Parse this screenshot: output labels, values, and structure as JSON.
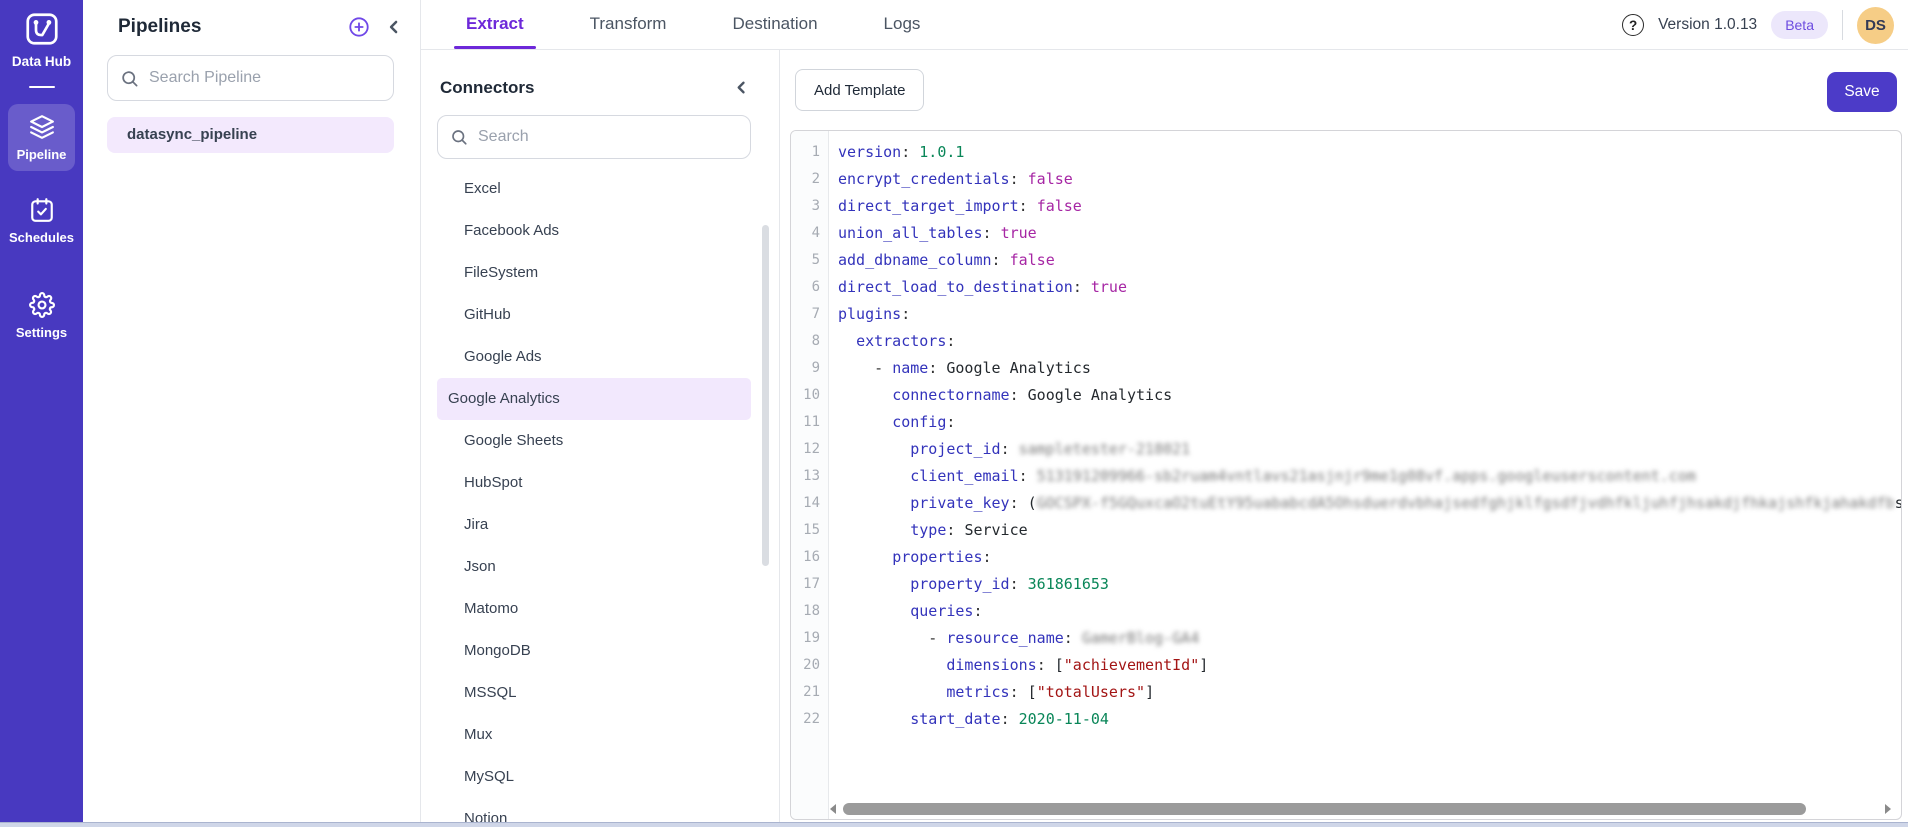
{
  "sidebar": {
    "logo_label": "Data Hub",
    "items": [
      {
        "label": "Pipeline",
        "active": true
      },
      {
        "label": "Schedules",
        "active": false
      },
      {
        "label": "Settings",
        "active": false
      }
    ]
  },
  "pipelines": {
    "title": "Pipelines",
    "search_placeholder": "Search Pipeline",
    "items": [
      {
        "name": "datasync_pipeline",
        "selected": true
      }
    ]
  },
  "tabs": [
    {
      "label": "Extract",
      "active": true
    },
    {
      "label": "Transform",
      "active": false
    },
    {
      "label": "Destination",
      "active": false
    },
    {
      "label": "Logs",
      "active": false
    }
  ],
  "topbar": {
    "version": "Version 1.0.13",
    "beta_label": "Beta",
    "help_glyph": "?",
    "avatar_initials": "DS"
  },
  "connectors": {
    "title": "Connectors",
    "search_placeholder": "Search",
    "selected": "Google Analytics",
    "items": [
      "Excel",
      "Facebook Ads",
      "FileSystem",
      "GitHub",
      "Google Ads",
      "Google Analytics",
      "Google Sheets",
      "HubSpot",
      "Jira",
      "Json",
      "Matomo",
      "MongoDB",
      "MSSQL",
      "Mux",
      "MySQL",
      "Notion"
    ]
  },
  "toolbar": {
    "add_template_label": "Add Template",
    "save_label": "Save"
  },
  "colors": {
    "accent_purple": "#6d28d9",
    "sidebar_bg": "#4839c0",
    "save_button": "#4c3bc8",
    "selection_lavender": "#f2e8fd",
    "beta_bg": "#ece7fb",
    "beta_text": "#6d4ce0",
    "avatar_bg": "#f6cd86",
    "code_key": "#3333bb",
    "code_bool": "#a626a4",
    "code_number": "#098658",
    "code_string": "#a31515"
  },
  "editor": {
    "language": "yaml",
    "lines": [
      {
        "no": 1,
        "seg": [
          [
            "version",
            "key"
          ],
          [
            ": ",
            "punc"
          ],
          [
            "1.0.1",
            "num"
          ]
        ]
      },
      {
        "no": 2,
        "seg": [
          [
            "encrypt_credentials",
            "key"
          ],
          [
            ": ",
            "punc"
          ],
          [
            "false",
            "bool"
          ]
        ]
      },
      {
        "no": 3,
        "seg": [
          [
            "direct_target_import",
            "key"
          ],
          [
            ": ",
            "punc"
          ],
          [
            "false",
            "bool"
          ]
        ]
      },
      {
        "no": 4,
        "seg": [
          [
            "union_all_tables",
            "key"
          ],
          [
            ": ",
            "punc"
          ],
          [
            "true",
            "bool"
          ]
        ]
      },
      {
        "no": 5,
        "seg": [
          [
            "add_dbname_column",
            "key"
          ],
          [
            ": ",
            "punc"
          ],
          [
            "false",
            "bool"
          ]
        ]
      },
      {
        "no": 6,
        "seg": [
          [
            "direct_load_to_destination",
            "key"
          ],
          [
            ": ",
            "punc"
          ],
          [
            "true",
            "bool"
          ]
        ]
      },
      {
        "no": 7,
        "seg": [
          [
            "plugins",
            "key"
          ],
          [
            ":",
            "punc"
          ]
        ]
      },
      {
        "no": 8,
        "seg": [
          [
            "  ",
            "plain"
          ],
          [
            "extractors",
            "key"
          ],
          [
            ":",
            "punc"
          ]
        ]
      },
      {
        "no": 9,
        "seg": [
          [
            "    - ",
            "punc"
          ],
          [
            "name",
            "key"
          ],
          [
            ": ",
            "punc"
          ],
          [
            "Google Analytics",
            "plain"
          ]
        ]
      },
      {
        "no": 10,
        "seg": [
          [
            "      ",
            "plain"
          ],
          [
            "connectorname",
            "key"
          ],
          [
            ": ",
            "punc"
          ],
          [
            "Google Analytics",
            "plain"
          ]
        ]
      },
      {
        "no": 11,
        "seg": [
          [
            "      ",
            "plain"
          ],
          [
            "config",
            "key"
          ],
          [
            ":",
            "punc"
          ]
        ]
      },
      {
        "no": 12,
        "seg": [
          [
            "        ",
            "plain"
          ],
          [
            "project_id",
            "key"
          ],
          [
            ": ",
            "punc"
          ],
          [
            "sampletester-218021",
            "redacted"
          ]
        ]
      },
      {
        "no": 13,
        "seg": [
          [
            "        ",
            "plain"
          ],
          [
            "client_email",
            "key"
          ],
          [
            ": ",
            "punc"
          ],
          [
            "513191209966-sb2ruam4vntlavs21asjnjr9me1g08vf.apps.googleuserscontent.com",
            "redacted"
          ]
        ]
      },
      {
        "no": 14,
        "seg": [
          [
            "        ",
            "plain"
          ],
          [
            "private_key",
            "key"
          ],
          [
            ": ",
            "punc"
          ],
          [
            "(",
            "plain"
          ],
          [
            "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sduerdvbhajsedfghjklfgsdfjvdhfkljuhfjhsakdjfhkajshfkjahakdfb",
            "redacted"
          ],
          [
            "sh",
            "plain"
          ]
        ]
      },
      {
        "no": 15,
        "seg": [
          [
            "        ",
            "plain"
          ],
          [
            "type",
            "key"
          ],
          [
            ": ",
            "punc"
          ],
          [
            "Service",
            "plain"
          ]
        ]
      },
      {
        "no": 16,
        "seg": [
          [
            "      ",
            "plain"
          ],
          [
            "properties",
            "key"
          ],
          [
            ":",
            "punc"
          ]
        ]
      },
      {
        "no": 17,
        "seg": [
          [
            "        ",
            "plain"
          ],
          [
            "property_id",
            "key"
          ],
          [
            ": ",
            "punc"
          ],
          [
            "361861653",
            "num"
          ]
        ]
      },
      {
        "no": 18,
        "seg": [
          [
            "        ",
            "plain"
          ],
          [
            "queries",
            "key"
          ],
          [
            ":",
            "punc"
          ]
        ]
      },
      {
        "no": 19,
        "seg": [
          [
            "          - ",
            "punc"
          ],
          [
            "resource_name",
            "key"
          ],
          [
            ": ",
            "punc"
          ],
          [
            "GamerBlog-GA4",
            "redacted"
          ]
        ]
      },
      {
        "no": 20,
        "seg": [
          [
            "            ",
            "plain"
          ],
          [
            "dimensions",
            "key"
          ],
          [
            ": ",
            "punc"
          ],
          [
            "[",
            "plain"
          ],
          [
            "\"achievementId\"",
            "str"
          ],
          [
            "]",
            "plain"
          ]
        ]
      },
      {
        "no": 21,
        "seg": [
          [
            "            ",
            "plain"
          ],
          [
            "metrics",
            "key"
          ],
          [
            ": ",
            "punc"
          ],
          [
            "[",
            "plain"
          ],
          [
            "\"totalUsers\"",
            "str"
          ],
          [
            "]",
            "plain"
          ]
        ]
      },
      {
        "no": 22,
        "seg": [
          [
            "        ",
            "plain"
          ],
          [
            "start_date",
            "key"
          ],
          [
            ": ",
            "punc"
          ],
          [
            "2020-11-04",
            "num"
          ]
        ]
      }
    ]
  }
}
